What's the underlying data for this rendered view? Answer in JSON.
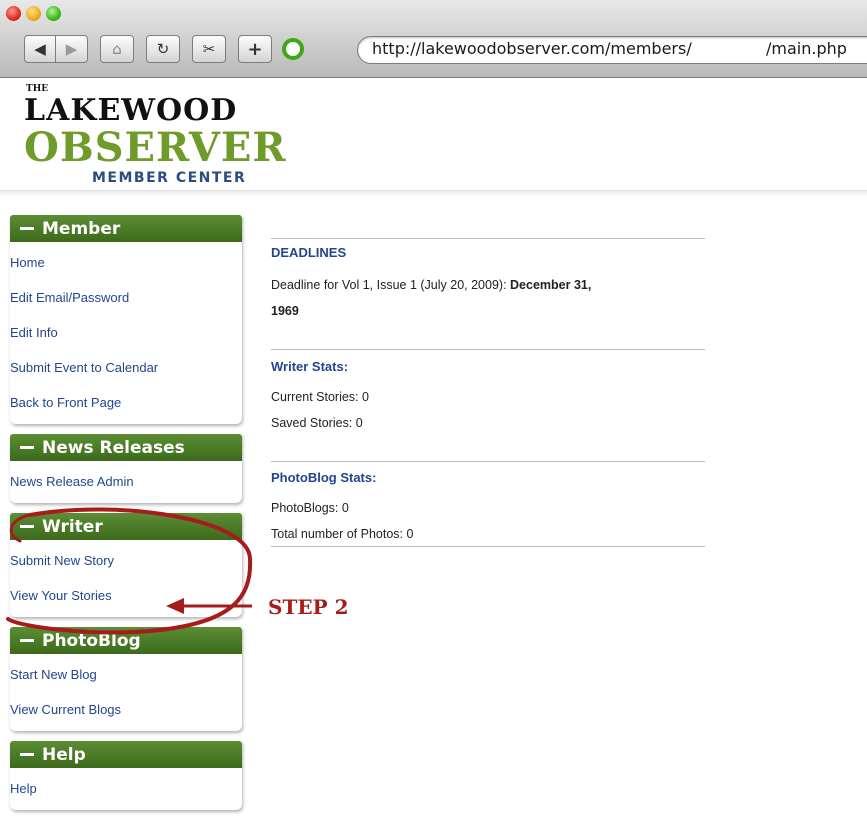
{
  "browser": {
    "url": "http://lakewoodobserver.com/members/",
    "url_tail": "/main.php",
    "buttons": {
      "back": "◀",
      "forward": "▶",
      "home": "⌂",
      "reload": "↻",
      "snip": "✂",
      "add": "+"
    }
  },
  "logo": {
    "the": "THE",
    "lakewood": "LAKEWOOD",
    "observer": "OBSERVER",
    "member_center": "MEMBER CENTER"
  },
  "sidebar": {
    "member": {
      "title": "Member",
      "links": [
        "Home",
        "Edit Email/Password",
        "Edit Info",
        "Submit Event to Calendar",
        "Back to Front Page"
      ]
    },
    "news": {
      "title": "News Releases",
      "links": [
        "News Release Admin"
      ]
    },
    "writer": {
      "title": "Writer",
      "links": [
        "Submit New Story",
        "View Your Stories"
      ]
    },
    "photoblog": {
      "title": "PhotoBlog",
      "links": [
        "Start New Blog",
        "View Current Blogs"
      ]
    },
    "help": {
      "title": "Help",
      "links": [
        "Help"
      ]
    }
  },
  "main": {
    "deadlines": {
      "title": "DEADLINES",
      "text_line1": "Deadline for Vol 1, Issue 1 (July 20, 2009): ",
      "bold_line1": "December 31,",
      "bold_line2": "1969"
    },
    "writer_stats": {
      "title": "Writer Stats:",
      "current": "Current Stories: 0",
      "saved": "Saved Stories: 0"
    },
    "photoblog_stats": {
      "title": "PhotoBlog Stats:",
      "blogs": "PhotoBlogs: 0",
      "photos": "Total number of Photos: 0"
    }
  },
  "annotation": {
    "label": "STEP 2",
    "color": "#a61c1c"
  },
  "colors": {
    "link": "#22468f",
    "header_green": "#4a7a25",
    "logo_green": "#6f9b2a"
  }
}
